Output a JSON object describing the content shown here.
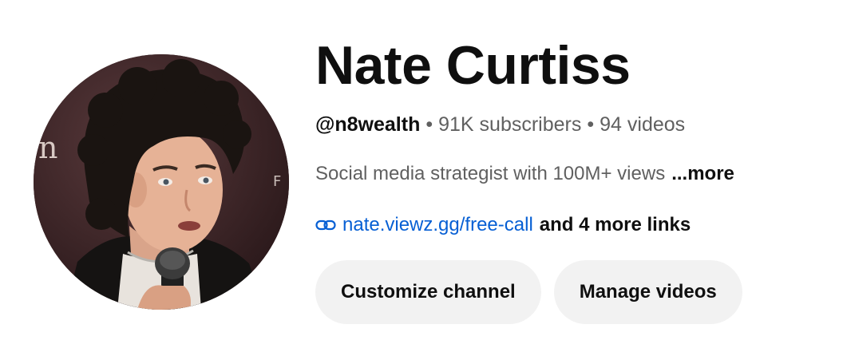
{
  "channel": {
    "name": "Nate Curtiss",
    "handle": "@n8wealth",
    "separator": "•",
    "subscribers": "91K subscribers",
    "videos": "94 videos",
    "description": "Social media strategist with 100M+ views",
    "more_label": "...more",
    "link_url": "nate.viewz.gg/free-call",
    "more_links": "and 4 more links",
    "avatar_icon": "profile-avatar"
  },
  "buttons": {
    "customize": "Customize channel",
    "manage": "Manage videos"
  },
  "colors": {
    "link": "#065fd4",
    "button_bg": "#f2f2f2",
    "secondary_text": "#606060",
    "primary_text": "#0f0f0f"
  }
}
